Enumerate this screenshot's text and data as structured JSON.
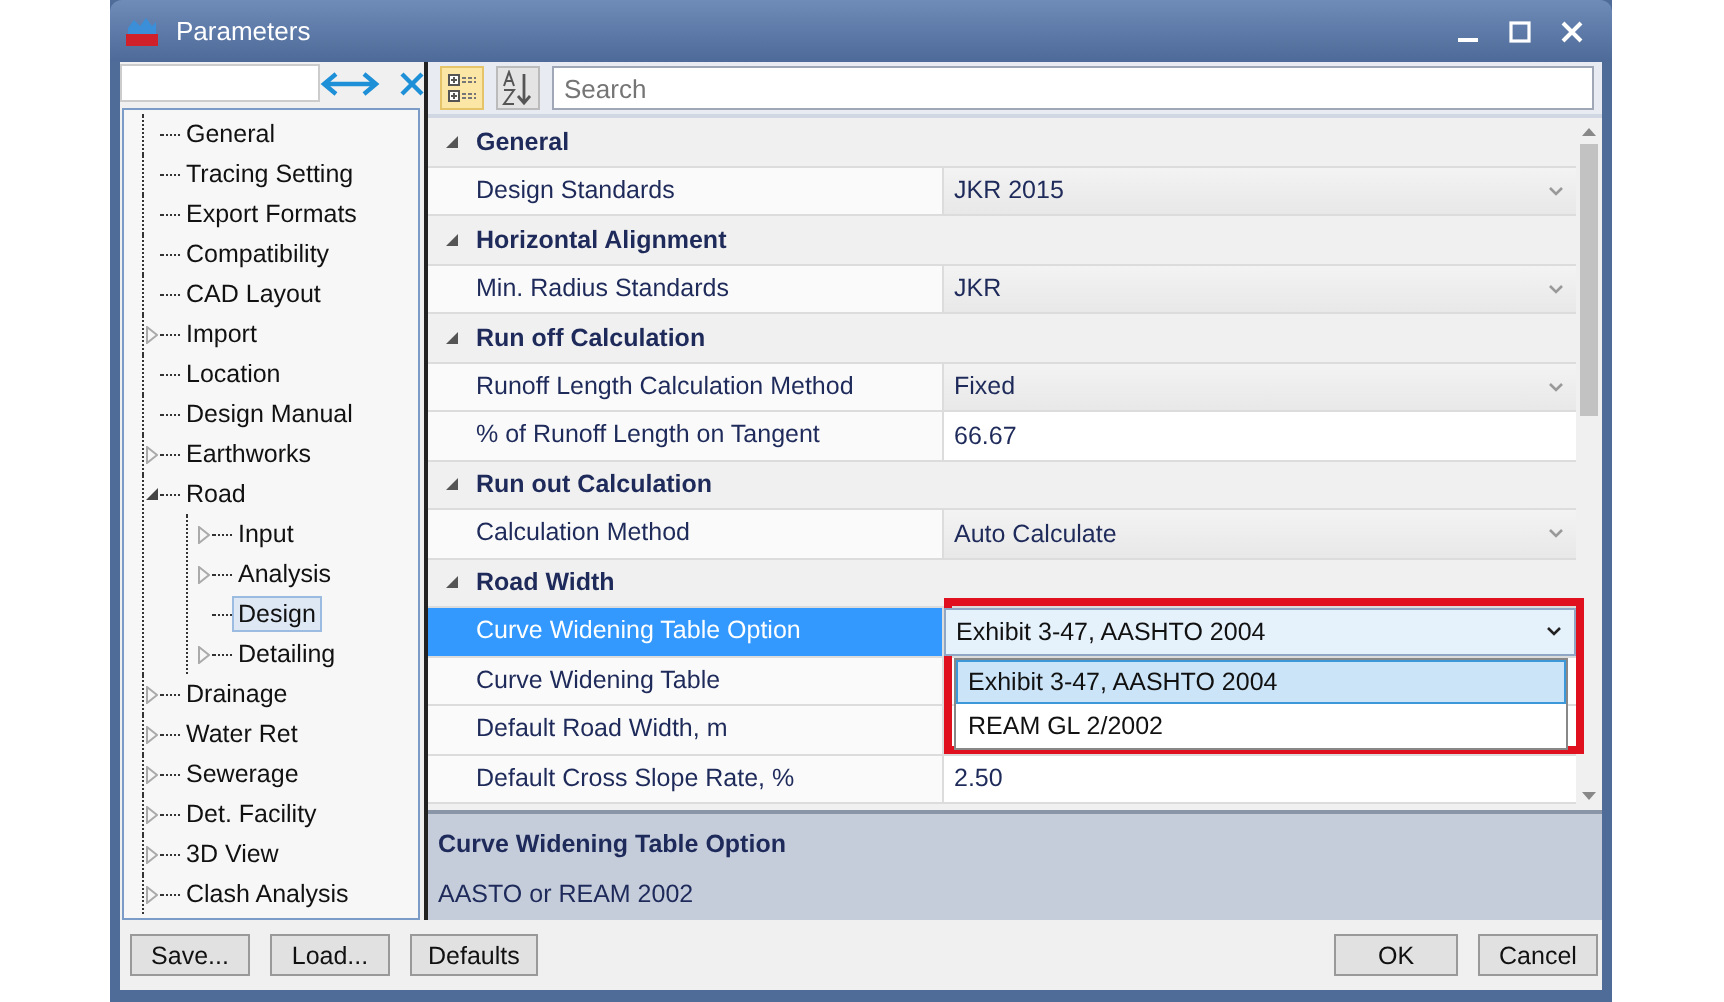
{
  "window": {
    "title": "Parameters"
  },
  "tree": [
    {
      "label": "General",
      "kind": "leaf",
      "selected": false
    },
    {
      "label": "Tracing Setting",
      "kind": "leaf",
      "selected": false
    },
    {
      "label": "Export Formats",
      "kind": "leaf",
      "selected": false
    },
    {
      "label": "Compatibility",
      "kind": "leaf",
      "selected": false
    },
    {
      "label": "CAD Layout",
      "kind": "leaf",
      "selected": false
    },
    {
      "label": "Import",
      "kind": "folder",
      "expanded": false,
      "selected": false
    },
    {
      "label": "Location",
      "kind": "leaf",
      "selected": false
    },
    {
      "label": "Design Manual",
      "kind": "leaf",
      "selected": false
    },
    {
      "label": "Earthworks",
      "kind": "folder",
      "expanded": false,
      "selected": false
    },
    {
      "label": "Road",
      "kind": "folder",
      "expanded": true,
      "selected": false,
      "children": [
        {
          "label": "Input",
          "kind": "folder",
          "expanded": false,
          "selected": false
        },
        {
          "label": "Analysis",
          "kind": "folder",
          "expanded": false,
          "selected": false
        },
        {
          "label": "Design",
          "kind": "leaf",
          "selected": true
        },
        {
          "label": "Detailing",
          "kind": "folder",
          "expanded": false,
          "selected": false
        }
      ]
    },
    {
      "label": "Drainage",
      "kind": "folder",
      "expanded": false,
      "selected": false
    },
    {
      "label": "Water Ret",
      "kind": "folder",
      "expanded": false,
      "selected": false
    },
    {
      "label": "Sewerage",
      "kind": "folder",
      "expanded": false,
      "selected": false
    },
    {
      "label": "Det. Facility",
      "kind": "folder",
      "expanded": false,
      "selected": false
    },
    {
      "label": "3D View",
      "kind": "folder",
      "expanded": false,
      "selected": false
    },
    {
      "label": "Clash Analysis",
      "kind": "folder",
      "expanded": false,
      "selected": false
    }
  ],
  "toolbar": {
    "categorized_selected": true,
    "alphabetical_selected": false,
    "search": {
      "placeholder": "Search"
    }
  },
  "property_grid": [
    {
      "name": "General",
      "expanded": true,
      "properties": [
        {
          "name": "Design Standards",
          "value": "JKR 2015",
          "kind": "dropdown",
          "selected": false
        }
      ]
    },
    {
      "name": "Horizontal Alignment",
      "expanded": true,
      "properties": [
        {
          "name": "Min. Radius Standards",
          "value": "JKR",
          "kind": "dropdown",
          "selected": false
        }
      ]
    },
    {
      "name": "Run off Calculation",
      "expanded": true,
      "properties": [
        {
          "name": "Runoff Length Calculation Method",
          "value": "Fixed",
          "kind": "dropdown",
          "selected": false
        },
        {
          "name": "% of Runoff Length on Tangent",
          "value": "66.67",
          "kind": "text",
          "selected": false
        }
      ]
    },
    {
      "name": "Run out Calculation",
      "expanded": true,
      "properties": [
        {
          "name": "Calculation Method",
          "value": "Auto Calculate",
          "kind": "dropdown",
          "selected": false
        }
      ]
    },
    {
      "name": "Road Width",
      "expanded": true,
      "properties": [
        {
          "name": "Curve Widening Table Option",
          "value": "Exhibit 3-47, AASHTO 2004",
          "kind": "dropdown",
          "selected": true,
          "open": true,
          "highlighted": true,
          "options": [
            {
              "label": "Exhibit 3-47, AASHTO 2004",
              "selected": true
            },
            {
              "label": "REAM GL 2/2002",
              "selected": false
            }
          ]
        },
        {
          "name": "Curve Widening Table",
          "kind": "text",
          "selected": false
        },
        {
          "name": "Default Road Width, m",
          "kind": "text",
          "selected": false
        },
        {
          "name": "Default Cross Slope Rate, %",
          "value": "2.50",
          "kind": "text",
          "selected": false
        }
      ]
    }
  ],
  "description": {
    "title": "Curve Widening Table Option",
    "text": "AASTO or REAM 2002"
  },
  "left_buttons": [
    "Save...",
    "Load...",
    "Defaults"
  ],
  "right_buttons": [
    "OK",
    "Cancel"
  ]
}
